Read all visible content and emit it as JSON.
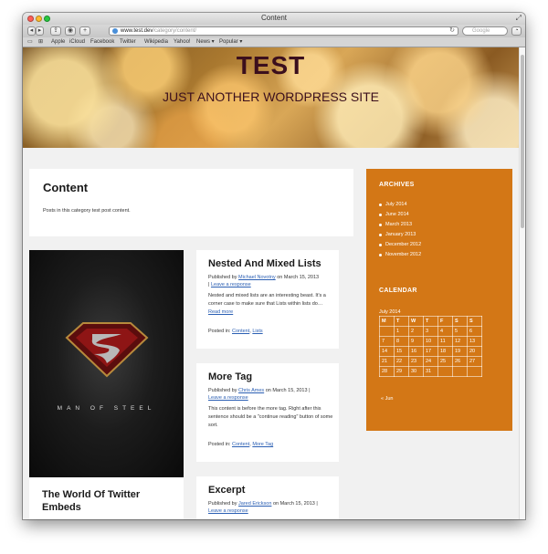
{
  "browser": {
    "window_title": "Content",
    "url_host": "www.test.dev",
    "url_path": "/category/content/",
    "search_placeholder": "Google",
    "bookmarks": [
      "Apple",
      "iCloud",
      "Facebook",
      "Twitter",
      "Wikipedia",
      "Yahoo!",
      "News ▾",
      "Popular ▾"
    ]
  },
  "site": {
    "title": "TEST",
    "description": "JUST ANOTHER WORDPRESS SITE"
  },
  "category": {
    "title": "Content",
    "description": "Posts in this category test post content."
  },
  "posts": [
    {
      "title": "Nested And Mixed Lists",
      "meta_prefix": "Published by",
      "author": "Michael Novotny",
      "date": "on March 15, 2013",
      "separator": "|",
      "response": "Leave a response",
      "excerpt": "Nested and mixed lists are an interesting beast. It's a corner case to make sure that Lists within lists do…",
      "read_more": "Read more",
      "posted_in_label": "Posted in:",
      "categories": [
        "Content",
        "Lists"
      ]
    },
    {
      "title": "More Tag",
      "meta_prefix": "Published by",
      "author": "Chris Ames",
      "date": "on March 15, 2013",
      "separator": "|",
      "response": "Leave a response",
      "excerpt": "This content is before the more tag. Right after this sentence should be a \"continue reading\" button of some sort.",
      "posted_in_label": "Posted in:",
      "categories": [
        "Content",
        "More Tag"
      ]
    },
    {
      "title": "Excerpt",
      "meta_prefix": "Published by",
      "author": "Jared Erickson",
      "date": "on March 15, 2013",
      "separator": "|",
      "response": "Leave a response"
    }
  ],
  "featured": {
    "image_caption": "MAN OF STEEL",
    "post_title": "The World Of Twitter Embeds"
  },
  "sidebar": {
    "archives_title": "ARCHIVES",
    "archives": [
      "July 2014",
      "June 2014",
      "March 2013",
      "January 2013",
      "December 2012",
      "November 2012"
    ],
    "calendar_title": "CALENDAR",
    "calendar_caption": "July 2014",
    "weekdays": [
      "M",
      "T",
      "W",
      "T",
      "F",
      "S",
      "S"
    ],
    "weeks": [
      [
        "",
        "1",
        "2",
        "3",
        "4",
        "5",
        "6"
      ],
      [
        "7",
        "8",
        "9",
        "10",
        "11",
        "12",
        "13"
      ],
      [
        "14",
        "15",
        "16",
        "17",
        "18",
        "19",
        "20"
      ],
      [
        "21",
        "22",
        "23",
        "24",
        "25",
        "26",
        "27"
      ],
      [
        "28",
        "29",
        "30",
        "31",
        "",
        "",
        ""
      ]
    ],
    "prev_month": "« Jun"
  },
  "colors": {
    "sidebar_bg": "#d37716",
    "site_title": "#3b0f1d",
    "link": "#2b5fb3"
  }
}
